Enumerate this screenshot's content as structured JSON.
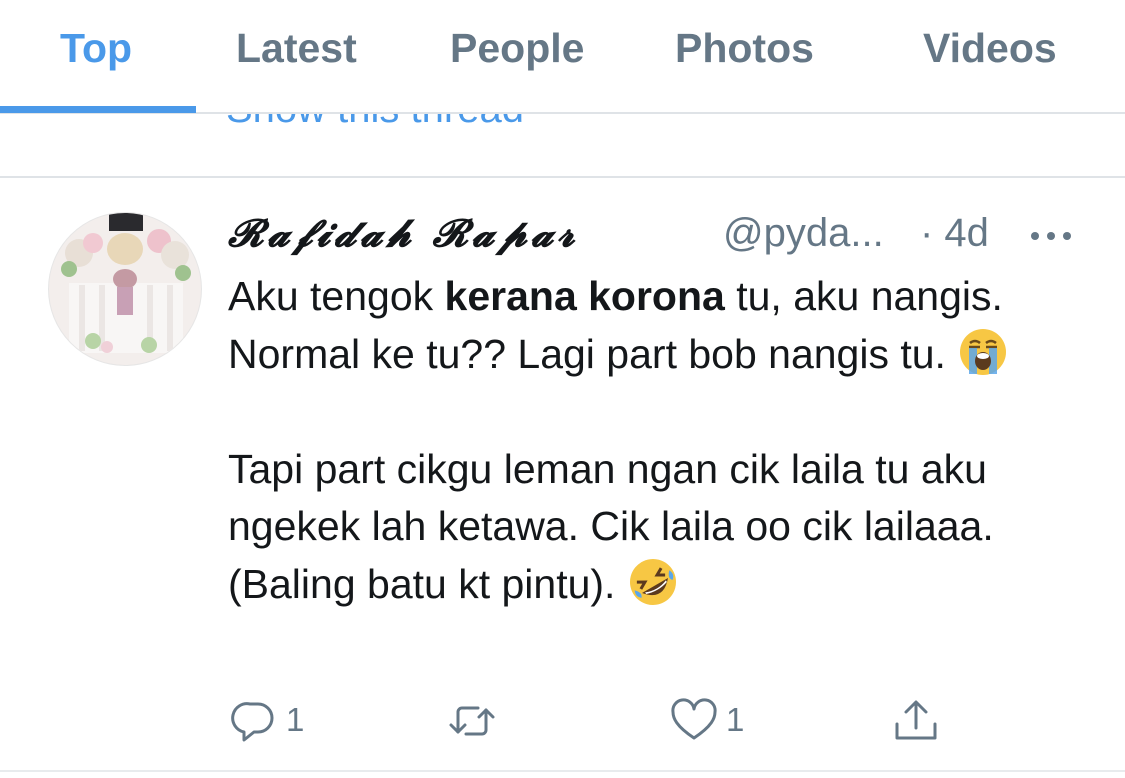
{
  "tabs": [
    {
      "label": "Top",
      "active": true
    },
    {
      "label": "Latest",
      "active": false
    },
    {
      "label": "People",
      "active": false
    },
    {
      "label": "Photos",
      "active": false
    },
    {
      "label": "Videos",
      "active": false
    }
  ],
  "previous_tweet": {
    "link_text": "Show this thread"
  },
  "tweet": {
    "display_name": "𝓡𝓪𝓯𝓲𝓭𝓪𝓱 𝓡𝓪𝓹𝓪𝓻",
    "handle": "@pyda...",
    "time": "· 4d",
    "body": {
      "p1_part1": "Aku tengok ",
      "p1_bold": "kerana korona",
      "p1_part2": " tu, aku nangis. Normal ke tu?? Lagi part bob nangis tu. ",
      "p2": "Tapi part cikgu leman ngan cik laila tu aku ngekek lah ketawa. Cik laila oo cik lailaaa. (Baling batu kt pintu). ",
      "p1_emoji": "loudly-crying-face",
      "p2_emoji": "rolling-on-the-floor-laughing"
    },
    "actions": {
      "reply_count": "1",
      "retweet_count": "",
      "like_count": "1"
    }
  },
  "icons": {
    "more": "more-horizontal-icon",
    "reply": "reply-icon",
    "retweet": "retweet-icon",
    "like": "heart-icon",
    "share": "share-icon"
  },
  "colors": {
    "accent": "#4a99e9",
    "secondary_text": "#657786",
    "primary_text": "#14171a",
    "divider": "#dfe3e7"
  }
}
